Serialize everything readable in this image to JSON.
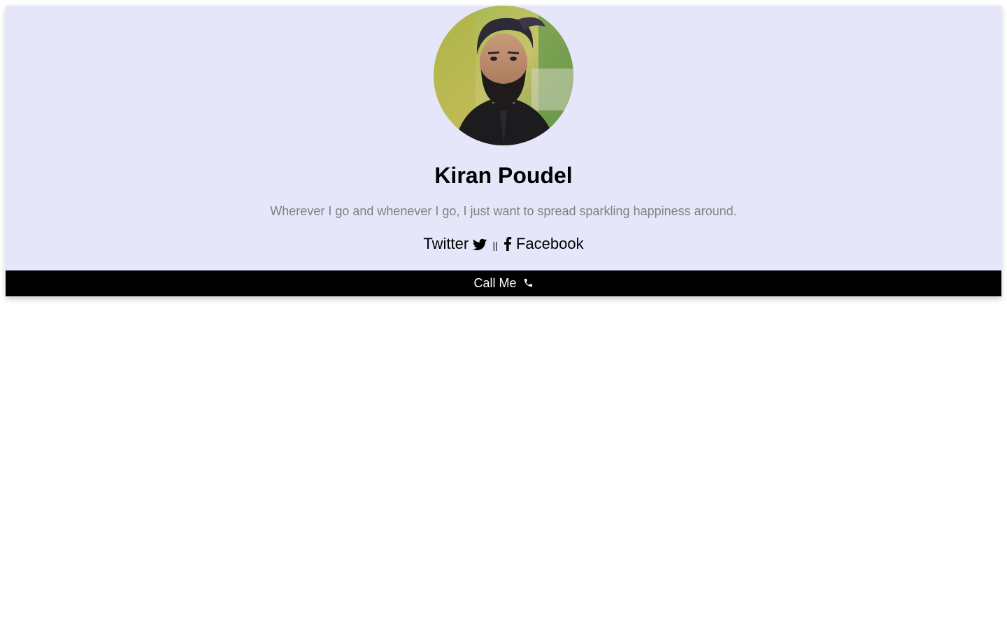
{
  "profile": {
    "name": "Kiran Poudel",
    "tagline": "Wherever I go and whenever I go, I just want to spread sparkling happiness around.",
    "avatar_alt": "profile-photo"
  },
  "links": {
    "twitter_label": "Twitter",
    "twitter_icon": "twitter-icon",
    "separator": "||",
    "facebook_icon": "facebook-icon",
    "facebook_label": "Facebook"
  },
  "action": {
    "call_label": "Call Me",
    "call_icon": "phone-icon"
  },
  "colors": {
    "card_background": "#e6e6fa",
    "button_background": "#000000",
    "button_text": "#ffffff",
    "tagline_text": "#808080"
  }
}
